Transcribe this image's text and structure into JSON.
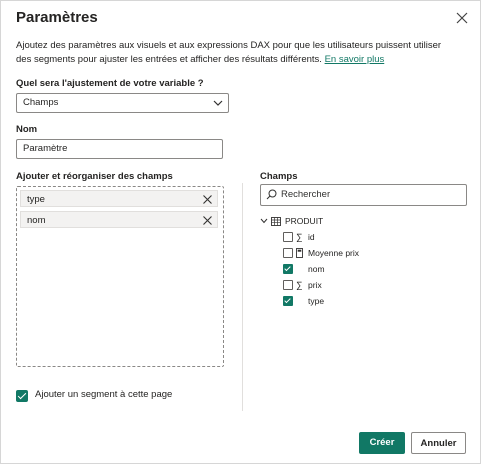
{
  "dialog": {
    "title": "Paramètres",
    "description": "Ajoutez des paramètres aux visuels et aux expressions DAX pour que les utilisateurs puissent utiliser des segments pour ajuster les entrées et afficher des résultats différents.",
    "learn_more": "En savoir plus"
  },
  "adjust": {
    "label": "Quel sera l'ajustement de votre variable ?",
    "value": "Champs"
  },
  "name": {
    "label": "Nom",
    "value": "Paramètre"
  },
  "fields_box": {
    "label": "Ajouter et réorganiser des champs",
    "chips": [
      "type",
      "nom"
    ]
  },
  "fields_pane": {
    "label": "Champs",
    "search_placeholder": "Rechercher",
    "table": "PRODUIT",
    "items": [
      {
        "name": "id",
        "icon": "sigma-icon",
        "checked": false
      },
      {
        "name": "Moyenne prix",
        "icon": "calculator-icon",
        "checked": false
      },
      {
        "name": "nom",
        "icon": "",
        "checked": true
      },
      {
        "name": "prix",
        "icon": "sigma-icon",
        "checked": false
      },
      {
        "name": "type",
        "icon": "",
        "checked": true
      }
    ]
  },
  "slicer": {
    "label": "Ajouter un segment à cette page",
    "checked": true
  },
  "buttons": {
    "create": "Créer",
    "cancel": "Annuler"
  },
  "colors": {
    "accent": "#117865"
  }
}
